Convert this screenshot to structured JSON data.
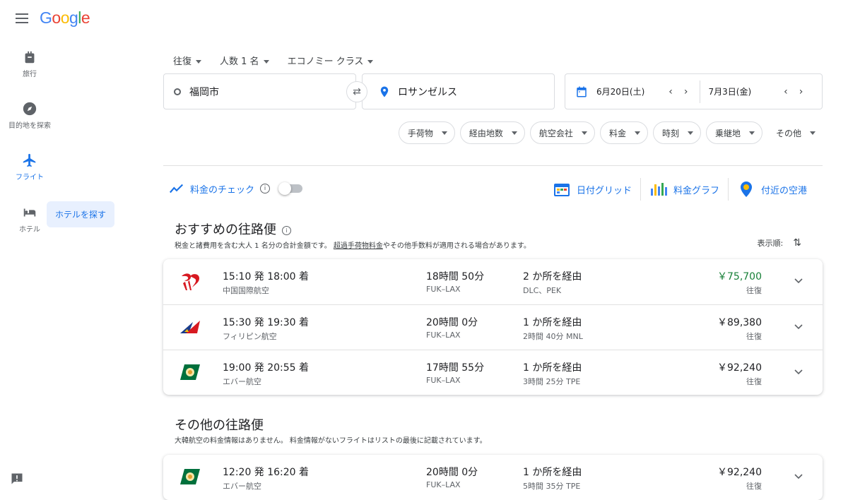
{
  "header": {
    "logo_text": "Google"
  },
  "sidebar": {
    "items": [
      {
        "label": "旅行",
        "icon": "luggage-icon"
      },
      {
        "label": "目的地を探索",
        "icon": "compass-icon"
      },
      {
        "label": "フライト",
        "icon": "airplane-icon",
        "active": true
      },
      {
        "label": "ホテル",
        "icon": "bed-icon"
      }
    ],
    "tooltip": "ホテルを探す"
  },
  "search": {
    "trip_type": "往復",
    "passengers": "人数 1 名",
    "cabin": "エコノミー クラス",
    "origin": "福岡市",
    "destination": "ロサンゼルス",
    "depart_date": "6月20日(土)",
    "return_date": "7月3日(金)"
  },
  "filters": [
    "手荷物",
    "経由地数",
    "航空会社",
    "料金",
    "時刻",
    "乗継地",
    "その他"
  ],
  "track_prices": {
    "label": "料金のチェック",
    "enabled": false
  },
  "tools": [
    {
      "label": "日付グリッド",
      "icon": "calendar-grid-icon"
    },
    {
      "label": "料金グラフ",
      "icon": "price-graph-icon"
    },
    {
      "label": "付近の空港",
      "icon": "map-pin-icon"
    }
  ],
  "recommended": {
    "title": "おすすめの往路便",
    "note_prefix": "税金と諸費用を含む大人 1 名分の合計金額です。",
    "note_link": "超過手荷物料金",
    "note_suffix": "やその他手数料が適用される場合があります。",
    "sort_label": "表示順:",
    "flights": [
      {
        "times": "15:10 発 18:00 着",
        "airline": "中国国際航空",
        "duration": "18時間 50分",
        "route": "FUK–LAX",
        "stops": "2 か所を経由",
        "stop_detail": "DLC、PEK",
        "price": "￥75,700",
        "price_type": "往復",
        "cheapest": true,
        "logo": "air-china-logo"
      },
      {
        "times": "15:30 発 19:30 着",
        "airline": "フィリピン航空",
        "duration": "20時間 0分",
        "route": "FUK–LAX",
        "stops": "1 か所を経由",
        "stop_detail": "2時間 40分 MNL",
        "price": "￥89,380",
        "price_type": "往復",
        "cheapest": false,
        "logo": "philippine-airlines-logo"
      },
      {
        "times": "19:00 発 20:55 着",
        "airline": "エバー航空",
        "duration": "17時間 55分",
        "route": "FUK–LAX",
        "stops": "1 か所を経由",
        "stop_detail": "3時間 25分 TPE",
        "price": "￥92,240",
        "price_type": "往復",
        "cheapest": false,
        "logo": "eva-air-logo"
      }
    ]
  },
  "other": {
    "title": "その他の往路便",
    "note": "大韓航空の料金情報はありません。 料金情報がないフライトはリストの最後に記載されています。",
    "flights": [
      {
        "times": "12:20 発 16:20 着",
        "airline": "エバー航空",
        "duration": "20時間 0分",
        "route": "FUK–LAX",
        "stops": "1 か所を経由",
        "stop_detail": "5時間 35分 TPE",
        "price": "￥92,240",
        "price_type": "往復",
        "logo": "eva-air-logo"
      }
    ]
  }
}
